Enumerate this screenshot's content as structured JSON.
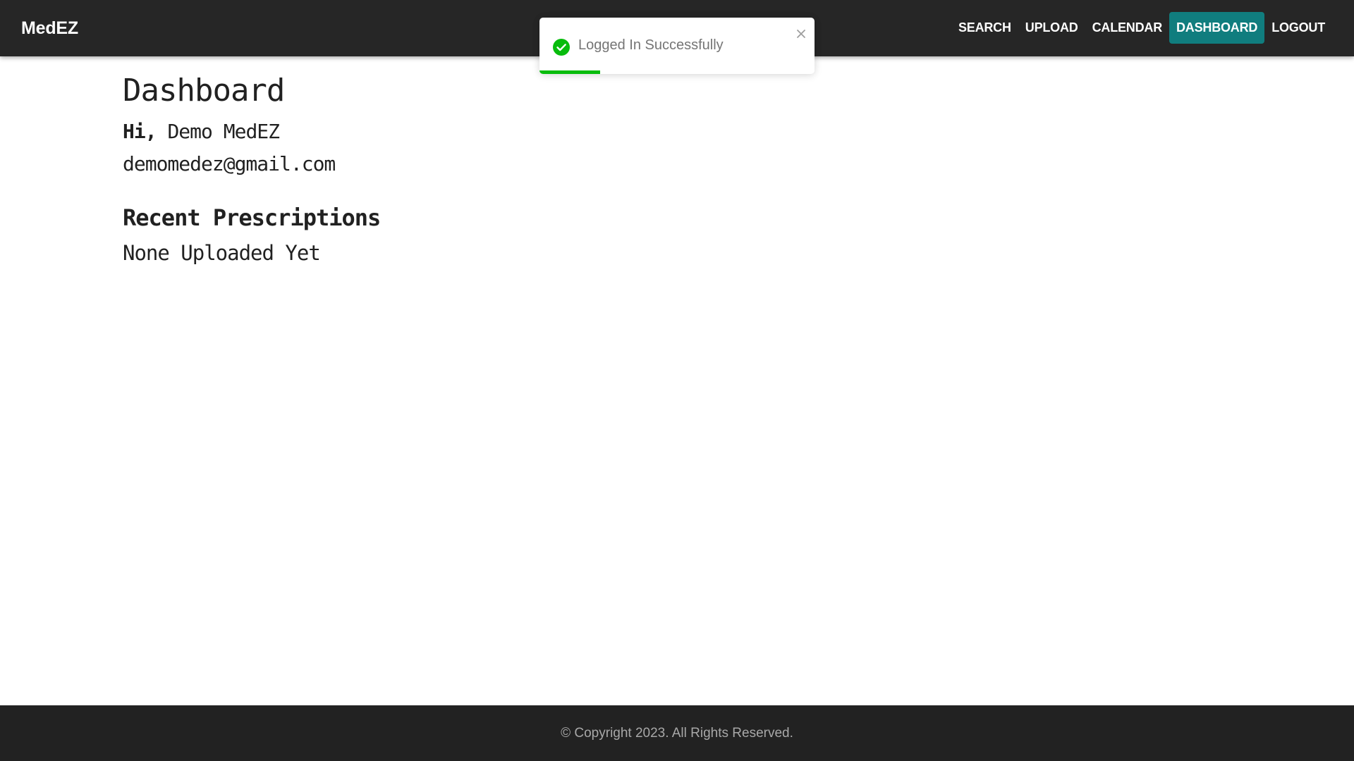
{
  "navbar": {
    "brand": "MedEZ",
    "links": [
      {
        "label": "SEARCH",
        "active": false
      },
      {
        "label": "UPLOAD",
        "active": false
      },
      {
        "label": "CALENDAR",
        "active": false
      },
      {
        "label": "DASHBOARD",
        "active": true
      },
      {
        "label": "LOGOUT",
        "active": false
      }
    ]
  },
  "toast": {
    "message": "Logged In Successfully",
    "icon": "check-circle-icon",
    "progress": 0.22,
    "status_color": "#07bc0c"
  },
  "main": {
    "title": "Dashboard",
    "greeting_prefix": "Hi,",
    "user_name": "Demo MedEZ",
    "email": "demomedez@gmail.com",
    "section_title": "Recent Prescriptions",
    "empty_message": "None Uploaded Yet"
  },
  "footer": {
    "text": "© Copyright 2023. All Rights Reserved."
  },
  "colors": {
    "navbar_bg": "#262626",
    "active_link_bg": "#107d7e",
    "footer_bg": "#222222",
    "success": "#07bc0c"
  }
}
